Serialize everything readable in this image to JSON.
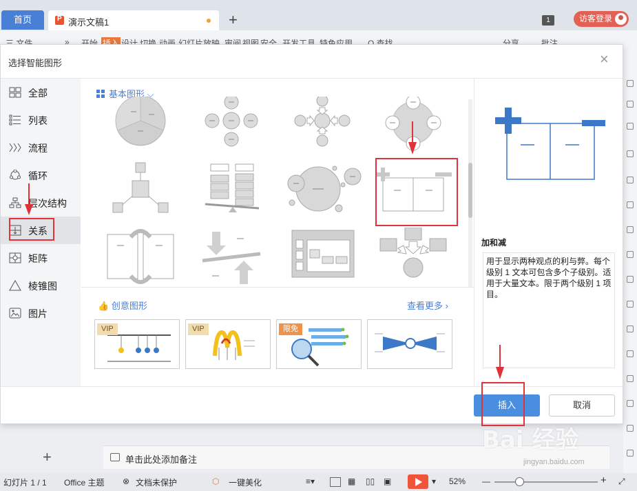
{
  "tabs": {
    "home": "首页",
    "doc": "演示文稿1",
    "add": "+"
  },
  "window": {
    "count": "1",
    "login": "访客登录"
  },
  "ribbon": {
    "items": [
      "三 文件",
      "»",
      "开始",
      "插入",
      "设计",
      "切换",
      "动画",
      "幻灯片放映",
      "审阅",
      "视图",
      "安全",
      "开发工具",
      "特色应用",
      "Q 查找",
      "分享",
      "批注"
    ]
  },
  "dialog": {
    "title": "选择智能图形",
    "close": "×",
    "categories": [
      {
        "label": "全部",
        "icon": "grid-icon"
      },
      {
        "label": "列表",
        "icon": "list-icon"
      },
      {
        "label": "流程",
        "icon": "process-chevron-icon"
      },
      {
        "label": "循环",
        "icon": "cycle-icon"
      },
      {
        "label": "层次结构",
        "icon": "hierarchy-icon"
      },
      {
        "label": "关系",
        "icon": "relationship-icon"
      },
      {
        "label": "矩阵",
        "icon": "matrix-icon"
      },
      {
        "label": "棱锥图",
        "icon": "pyramid-icon"
      },
      {
        "label": "图片",
        "icon": "picture-icon"
      }
    ],
    "active_category": "关系",
    "basic_section": "基本图形",
    "creative_section": "创意图形",
    "see_more": "查看更多",
    "creative_cards": [
      {
        "badge": "VIP"
      },
      {
        "badge": "VIP"
      },
      {
        "badge": "限免"
      },
      {
        "badge": ""
      }
    ],
    "preview": {
      "name": "加和减",
      "description": "用于显示两种观点的利与弊。每个级别 1 文本可包含多个子级别。适用于大量文本。限于两个级别 1 项目。"
    },
    "insert": "插入",
    "cancel": "取消"
  },
  "notes": {
    "placeholder": "单击此处添加备注"
  },
  "status": {
    "slide": "幻灯片 1 / 1",
    "theme": "Office 主题",
    "protect": "文档未保护",
    "beautify": "一键美化",
    "zoom": "52%"
  },
  "watermark": {
    "logo": "Bai 经验",
    "url": "jingyan.baidu.com"
  },
  "colors": {
    "accent": "#4a7fd6",
    "annotation": "#e0323a",
    "insert_button": "#4a8ee0"
  }
}
